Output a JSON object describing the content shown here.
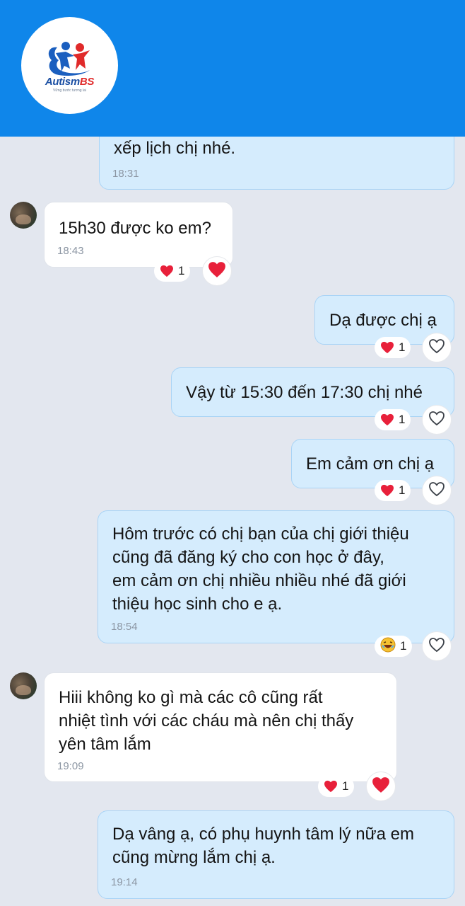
{
  "brand": {
    "name_main": "Autism",
    "name_accent": "BS",
    "tagline": "Vững bước tương lai",
    "colors": {
      "header": "#0f86ea",
      "heart": "#e8203a",
      "outgoing": "#d5ecfd"
    }
  },
  "messages": [
    {
      "id": "m1",
      "direction": "out",
      "text": "xếp lịch chị nhé.",
      "time": "18:31"
    },
    {
      "id": "m2",
      "direction": "in",
      "text": "15h30 được ko em?",
      "time": "18:43",
      "reaction": {
        "emoji": "heart",
        "count": "1"
      },
      "my_reaction": "heart-filled"
    },
    {
      "id": "m3",
      "direction": "out",
      "text": "Dạ được chị ạ",
      "reaction": {
        "emoji": "heart",
        "count": "1"
      },
      "my_reaction": "heart-outline"
    },
    {
      "id": "m4",
      "direction": "out",
      "text": "Vậy từ 15:30 đến 17:30 chị nhé",
      "reaction": {
        "emoji": "heart",
        "count": "1"
      },
      "my_reaction": "heart-outline"
    },
    {
      "id": "m5",
      "direction": "out",
      "text": "Em cảm ơn chị ạ",
      "reaction": {
        "emoji": "heart",
        "count": "1"
      },
      "my_reaction": "heart-outline"
    },
    {
      "id": "m6",
      "direction": "out",
      "text": "Hôm trước có chị bạn của chị giới thiệu\ncũng đã đăng ký cho con học ở đây,\nem cảm ơn chị nhiều nhiều nhé đã giới\nthiệu học sinh cho e ạ.",
      "time": "18:54",
      "reaction": {
        "emoji": "laughing",
        "count": "1"
      },
      "my_reaction": "heart-outline"
    },
    {
      "id": "m7",
      "direction": "in",
      "text": "Hiii không ko gì mà các cô cũng rất\nnhiệt tình với các cháu mà nên chị thấy\nyên tâm lắm",
      "time": "19:09",
      "reaction": {
        "emoji": "heart",
        "count": "1"
      },
      "my_reaction": "heart-filled"
    },
    {
      "id": "m8",
      "direction": "out",
      "text": "Dạ vâng ạ, có phụ huynh tâm lý nữa em\ncũng mừng lắm chị ạ.",
      "time": "19:14"
    }
  ]
}
